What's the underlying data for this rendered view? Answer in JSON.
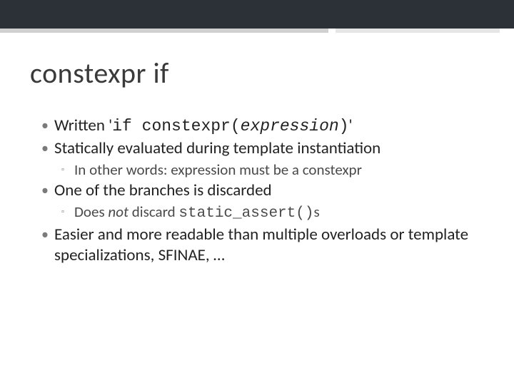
{
  "title": "constexpr if",
  "bullets": {
    "b1": {
      "pre": "Written '",
      "code1": "if constexpr(",
      "codeItal": "expression",
      "code2": ")",
      "post": "'"
    },
    "b2": "Statically evaluated during template instantiation",
    "b2s1": "In other words: expression must be a constexpr",
    "b3": "One of the branches is discarded",
    "b3s1": {
      "pre": "Does ",
      "ital": "not",
      "mid": " discard ",
      "code": "static_assert()",
      "post": "s"
    },
    "b4": "Easier and more readable than multiple overloads or template specializations, SFINAE, …"
  }
}
